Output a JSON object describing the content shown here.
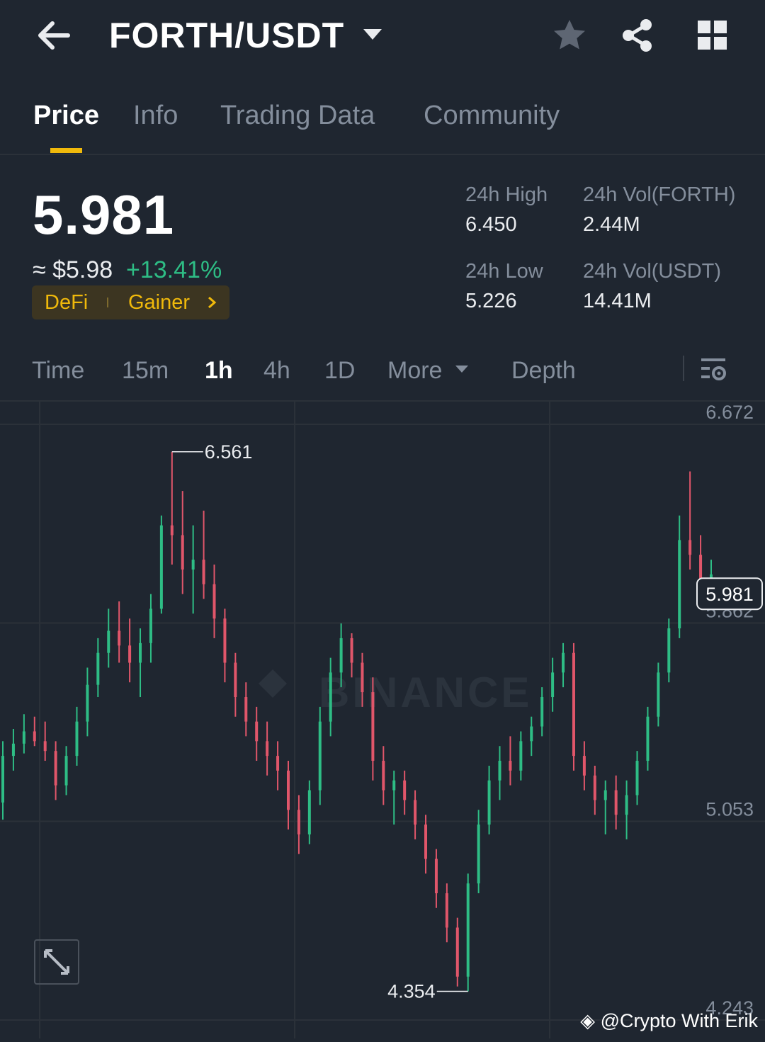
{
  "header": {
    "pair": "FORTH/USDT",
    "icons": [
      "back-arrow-icon",
      "caret-down-icon",
      "star-icon",
      "share-icon",
      "grid-icon"
    ]
  },
  "tabs": [
    {
      "label": "Price",
      "active": true
    },
    {
      "label": "Info",
      "active": false
    },
    {
      "label": "Trading Data",
      "active": false
    },
    {
      "label": "Community",
      "active": false
    }
  ],
  "price": {
    "last": "5.981",
    "fiat": "≈ $5.98",
    "change": "+13.41%",
    "tags": [
      "DeFi",
      "Gainer"
    ]
  },
  "stats": {
    "high_label": "24h High",
    "high_value": "6.450",
    "low_label": "24h Low",
    "low_value": "5.226",
    "vol_base_label": "24h Vol(FORTH)",
    "vol_base_value": "2.44M",
    "vol_quote_label": "24h Vol(USDT)",
    "vol_quote_value": "14.41M"
  },
  "intervals": {
    "items": [
      "Time",
      "15m",
      "1h",
      "4h",
      "1D",
      "More",
      "Depth"
    ],
    "active": "1h"
  },
  "colors": {
    "up": "#2ebd85",
    "down": "#e0566a",
    "accent": "#f0b90b",
    "background": "#1f2630"
  },
  "chart_data": {
    "type": "candlestick",
    "interval": "1h",
    "y_axis_labels": [
      "6.672",
      "5.862",
      "5.053",
      "4.243"
    ],
    "ylim": [
      4.243,
      6.672
    ],
    "max_marker": "6.561",
    "min_marker": "4.354",
    "last_price_label": "5.981",
    "watermark": "BINANCE",
    "credit": "@Crypto With Erik",
    "candles": [
      [
        5.13,
        5.38,
        5.06,
        5.32
      ],
      [
        5.32,
        5.43,
        5.26,
        5.37
      ],
      [
        5.37,
        5.49,
        5.33,
        5.42
      ],
      [
        5.42,
        5.48,
        5.36,
        5.38
      ],
      [
        5.38,
        5.46,
        5.3,
        5.34
      ],
      [
        5.34,
        5.38,
        5.14,
        5.2
      ],
      [
        5.2,
        5.36,
        5.16,
        5.32
      ],
      [
        5.32,
        5.52,
        5.28,
        5.46
      ],
      [
        5.46,
        5.68,
        5.4,
        5.61
      ],
      [
        5.61,
        5.8,
        5.56,
        5.74
      ],
      [
        5.74,
        5.92,
        5.68,
        5.83
      ],
      [
        5.83,
        5.95,
        5.7,
        5.77
      ],
      [
        5.77,
        5.88,
        5.62,
        5.7
      ],
      [
        5.7,
        5.84,
        5.56,
        5.78
      ],
      [
        5.78,
        5.98,
        5.7,
        5.92
      ],
      [
        5.92,
        6.3,
        5.9,
        6.26
      ],
      [
        6.26,
        6.56,
        6.1,
        6.22
      ],
      [
        6.22,
        6.4,
        5.98,
        6.08
      ],
      [
        6.08,
        6.26,
        5.9,
        6.12
      ],
      [
        6.12,
        6.32,
        5.96,
        6.02
      ],
      [
        6.02,
        6.1,
        5.8,
        5.88
      ],
      [
        5.88,
        5.92,
        5.62,
        5.7
      ],
      [
        5.7,
        5.74,
        5.48,
        5.56
      ],
      [
        5.56,
        5.62,
        5.4,
        5.46
      ],
      [
        5.46,
        5.52,
        5.3,
        5.38
      ],
      [
        5.38,
        5.46,
        5.24,
        5.32
      ],
      [
        5.32,
        5.38,
        5.18,
        5.26
      ],
      [
        5.26,
        5.3,
        5.02,
        5.1
      ],
      [
        5.1,
        5.16,
        4.92,
        5.0
      ],
      [
        5.0,
        5.22,
        4.96,
        5.18
      ],
      [
        5.18,
        5.52,
        5.12,
        5.46
      ],
      [
        5.46,
        5.72,
        5.4,
        5.66
      ],
      [
        5.66,
        5.86,
        5.6,
        5.8
      ],
      [
        5.8,
        5.82,
        5.64,
        5.7
      ],
      [
        5.7,
        5.74,
        5.52,
        5.58
      ],
      [
        5.58,
        5.64,
        5.22,
        5.3
      ],
      [
        5.3,
        5.36,
        5.12,
        5.18
      ],
      [
        5.18,
        5.26,
        5.04,
        5.22
      ],
      [
        5.22,
        5.26,
        5.08,
        5.14
      ],
      [
        5.14,
        5.18,
        4.98,
        5.04
      ],
      [
        5.04,
        5.08,
        4.84,
        4.9
      ],
      [
        4.9,
        4.94,
        4.7,
        4.76
      ],
      [
        4.76,
        4.8,
        4.56,
        4.62
      ],
      [
        4.62,
        4.66,
        4.38,
        4.42
      ],
      [
        4.42,
        4.84,
        4.36,
        4.8
      ],
      [
        4.8,
        5.1,
        4.76,
        5.04
      ],
      [
        5.04,
        5.28,
        5.0,
        5.22
      ],
      [
        5.22,
        5.36,
        5.14,
        5.3
      ],
      [
        5.3,
        5.4,
        5.2,
        5.26
      ],
      [
        5.26,
        5.42,
        5.22,
        5.38
      ],
      [
        5.38,
        5.48,
        5.32,
        5.44
      ],
      [
        5.44,
        5.6,
        5.4,
        5.56
      ],
      [
        5.56,
        5.72,
        5.5,
        5.66
      ],
      [
        5.66,
        5.78,
        5.6,
        5.74
      ],
      [
        5.74,
        5.78,
        5.26,
        5.32
      ],
      [
        5.32,
        5.38,
        5.18,
        5.24
      ],
      [
        5.24,
        5.28,
        5.08,
        5.14
      ],
      [
        5.14,
        5.22,
        5.0,
        5.18
      ],
      [
        5.18,
        5.24,
        5.02,
        5.08
      ],
      [
        5.08,
        5.22,
        4.98,
        5.16
      ],
      [
        5.16,
        5.34,
        5.12,
        5.3
      ],
      [
        5.3,
        5.52,
        5.26,
        5.48
      ],
      [
        5.48,
        5.7,
        5.44,
        5.66
      ],
      [
        5.66,
        5.88,
        5.62,
        5.84
      ],
      [
        5.84,
        6.3,
        5.8,
        6.2
      ],
      [
        6.2,
        6.48,
        6.08,
        6.14
      ],
      [
        6.14,
        6.22,
        5.92,
        6.0
      ],
      [
        6.0,
        6.12,
        5.94,
        6.06
      ]
    ]
  }
}
